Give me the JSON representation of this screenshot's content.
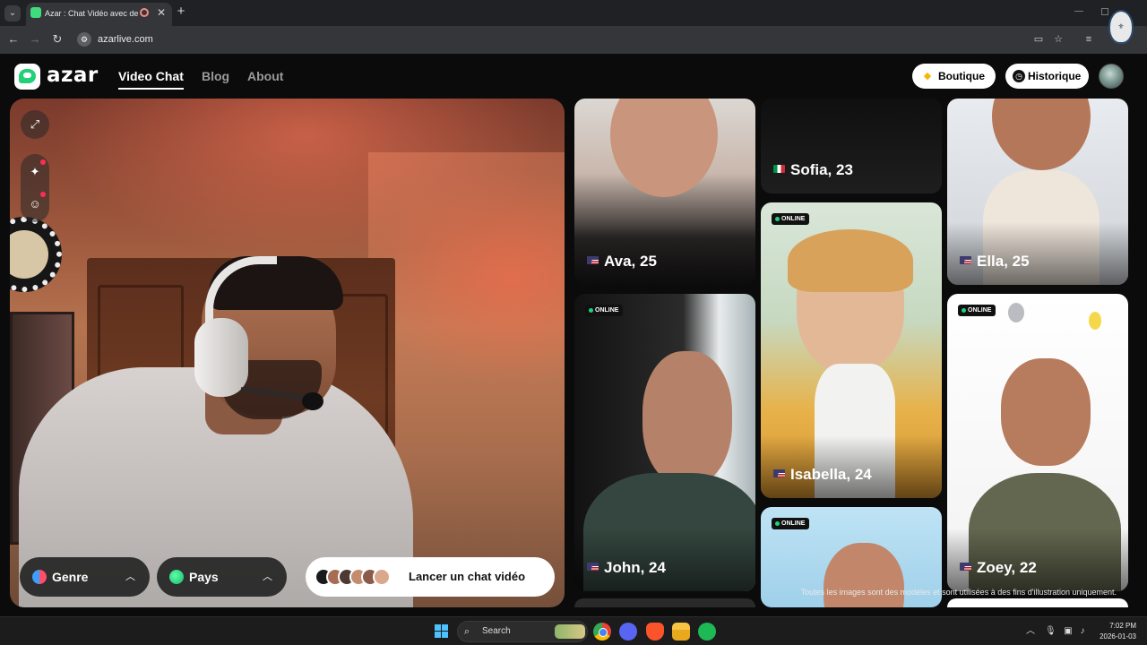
{
  "browser": {
    "tab_title": "Azar : Chat Vidéo avec de n",
    "url": "azarlive.com"
  },
  "header": {
    "logo_text": "azar",
    "nav": [
      "Video Chat",
      "Blog",
      "About"
    ],
    "boutique_label": "Boutique",
    "historique_label": "Historique"
  },
  "camera": {
    "filters": [
      {
        "label": "Genre",
        "icon": "gender-icon"
      },
      {
        "label": "Pays",
        "icon": "globe-icon"
      }
    ],
    "launch_label": "Lancer un chat vidéo"
  },
  "profiles": [
    {
      "name": "Ava, 25",
      "flag": "us",
      "online": false
    },
    {
      "name": "Sofia, 23",
      "flag": "it",
      "online": false
    },
    {
      "name": "Ella, 25",
      "flag": "us",
      "online": false
    },
    {
      "name": "Isabella, 24",
      "flag": "us",
      "online": true
    },
    {
      "name": "John, 24",
      "flag": "us",
      "online": true
    },
    {
      "name": "Zoey, 22",
      "flag": "us",
      "online": true
    },
    {
      "name": "",
      "flag": "",
      "online": true
    }
  ],
  "online_label": "ONLINE",
  "disclaimer": "Toutes les images sont des modèles et sont utilisées à des fins d'illustration uniquement.",
  "taskbar": {
    "search_label": "Search",
    "time": "7:02 PM",
    "date": "2026-01-03"
  },
  "colors": {
    "brand_green": "#21d07a",
    "online_dot": "#21d07a",
    "notification_red": "#ff2d55"
  }
}
